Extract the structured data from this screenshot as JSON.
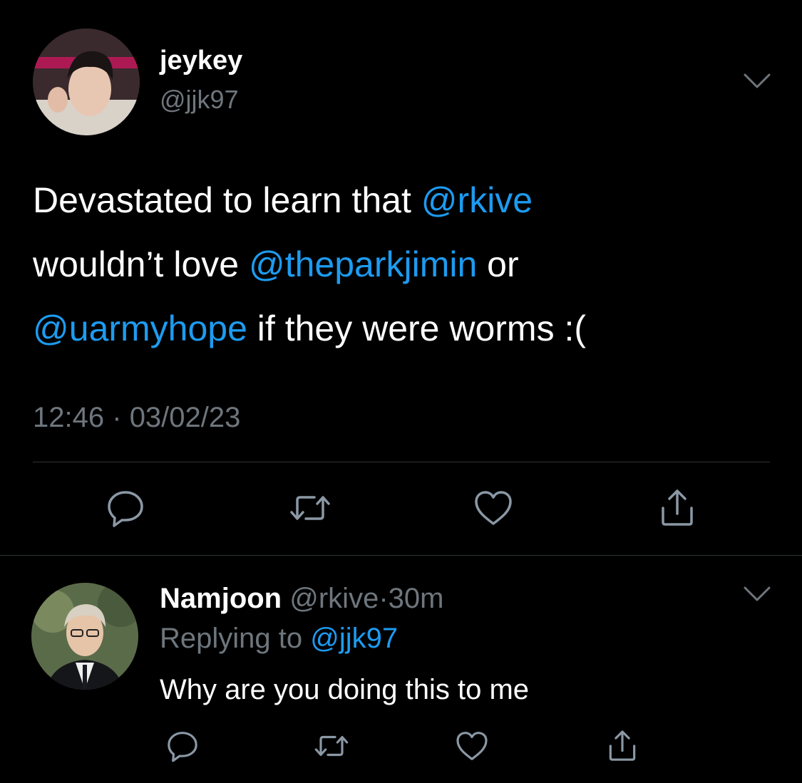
{
  "tweet": {
    "display_name": "jeykey",
    "handle": "@jjk97",
    "text_segments": [
      {
        "text": "Devastated to learn that ",
        "mention": false
      },
      {
        "text": "@rkive",
        "mention": true
      },
      {
        "text": " wouldn’t love ",
        "mention": false
      },
      {
        "text": "@theparkjimin",
        "mention": true
      },
      {
        "text": " or ",
        "mention": false
      },
      {
        "text": "@uarmyhope",
        "mention": true
      },
      {
        "text": " if they were worms :(",
        "mention": false
      }
    ],
    "time": "12:46",
    "separator": "·",
    "date": "03/02/23",
    "actions": [
      "reply-icon",
      "retweet-icon",
      "like-icon",
      "share-icon"
    ]
  },
  "reply": {
    "display_name": "Namjoon",
    "handle": "@rkive",
    "separator": "·",
    "age": "30m",
    "replying_to_label": "Replying to",
    "replying_to_handle": "@jjk97",
    "text": "Why are you doing this to me",
    "actions": [
      "reply-icon",
      "retweet-icon",
      "like-icon",
      "share-icon"
    ]
  },
  "colors": {
    "background": "#000000",
    "text": "#ffffff",
    "muted": "#6e767d",
    "link": "#1d9bf0",
    "divider": "#2f3336"
  }
}
